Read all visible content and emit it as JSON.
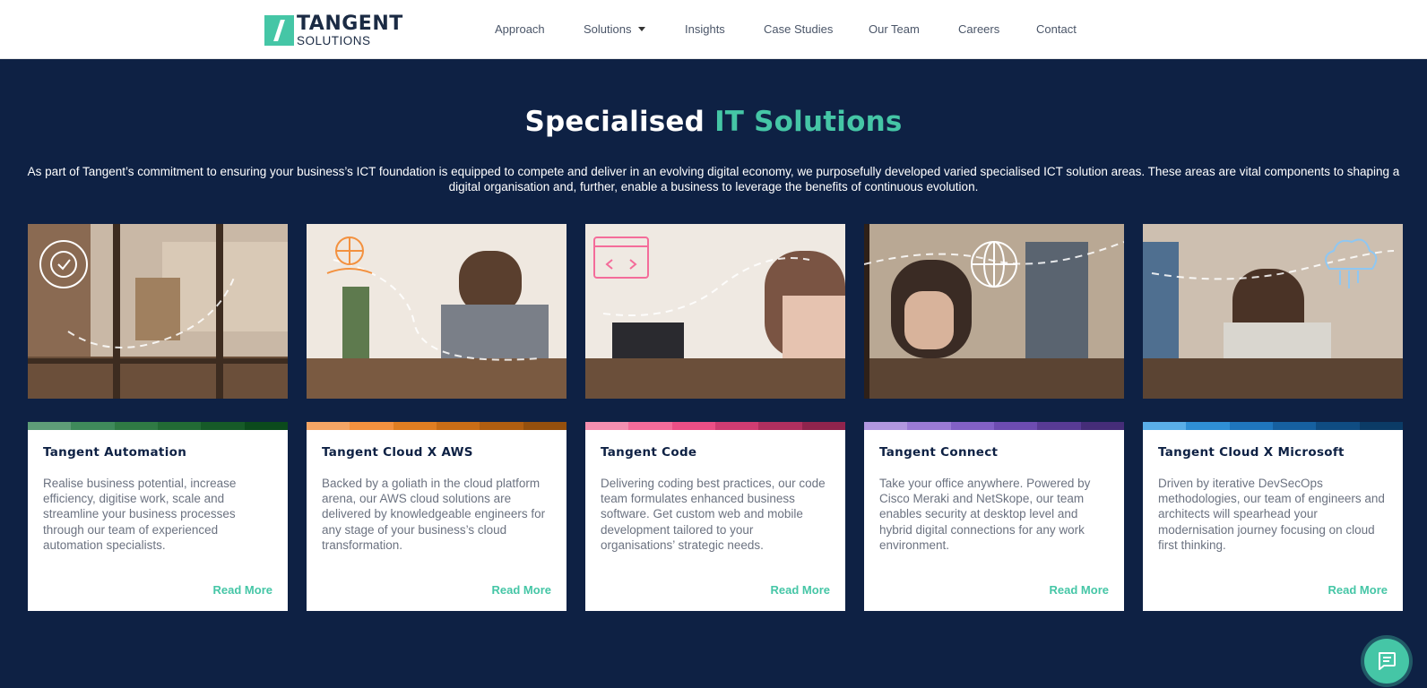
{
  "brand": {
    "name_top": "TANGENT",
    "name_bottom": "SOLUTIONS",
    "accent_color": "#45c6a6",
    "navy": "#0e2144"
  },
  "nav": {
    "approach": "Approach",
    "solutions": "Solutions",
    "insights": "Insights",
    "case_studies": "Case Studies",
    "our_team": "Our Team",
    "careers": "Careers",
    "contact": "Contact"
  },
  "hero": {
    "title_plain": "Specialised",
    "title_accent": "IT Solutions",
    "intro": "As part of Tangent’s commitment to ensuring your business’s ICT foundation is equipped to compete and deliver in an evolving digital economy, we purposefully developed varied specialised ICT solution areas. These areas are vital components to shaping a digital organisation and, further, enable a business to leverage the benefits of continuous evolution."
  },
  "cards": [
    {
      "title": "Tangent Automation",
      "desc": "Realise business potential, increase efficiency, digitise work, scale and streamline your business processes through our team of experienced automation specialists.",
      "link": "Read More",
      "icon": "automation-cycle-icon",
      "strip": [
        "#5e9d78",
        "#3f8a5b",
        "#2f7a44",
        "#226b35",
        "#165a28",
        "#0b4a1c"
      ]
    },
    {
      "title": "Tangent Cloud X AWS",
      "desc": "Backed by a goliath in the cloud platform arena, our AWS cloud solutions are delivered by knowledgeable engineers for any stage of your business’s cloud transformation.",
      "link": "Read More",
      "icon": "globe-hand-icon",
      "strip": [
        "#f5a565",
        "#f3913f",
        "#e07e22",
        "#c96d16",
        "#b05e10",
        "#95500d"
      ]
    },
    {
      "title": "Tangent Code",
      "desc": "Delivering coding best practices, our code team formulates enhanced business software. Get custom web and mobile development tailored to your organisations’ strategic needs.",
      "link": "Read More",
      "icon": "code-window-icon",
      "strip": [
        "#f58fb0",
        "#f46c9a",
        "#ec4f86",
        "#cf3c72",
        "#b02f5f",
        "#8f244d"
      ]
    },
    {
      "title": "Tangent Connect",
      "desc": "Take your office anywhere. Powered by Cisco Meraki and NetSkope, our team enables security at desktop level and hybrid digital connections for any work environment.",
      "link": "Read More",
      "icon": "network-globe-icon",
      "strip": [
        "#b197e0",
        "#9a7bd6",
        "#8261c6",
        "#6d4cb1",
        "#583b95",
        "#452d78"
      ]
    },
    {
      "title": "Tangent Cloud X Microsoft",
      "desc": "Driven by iterative DevSecOps methodologies, our team of engineers and architects will spearhead your modernisation journey focusing on cloud first thinking.",
      "link": "Read More",
      "icon": "cloud-circuit-icon",
      "strip": [
        "#5aaee8",
        "#2f8fd6",
        "#1f76bd",
        "#1660a0",
        "#0f4c82",
        "#0b3b66"
      ]
    }
  ],
  "chat": {
    "icon": "chat-icon"
  }
}
